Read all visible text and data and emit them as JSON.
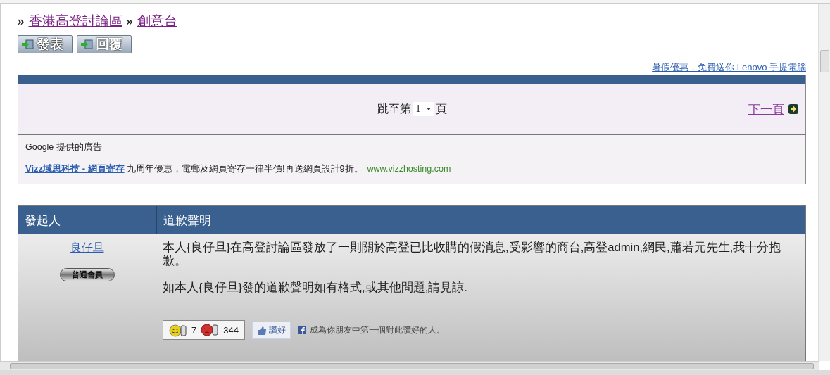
{
  "breadcrumb": [
    {
      "kind": "sep",
      "text": "»"
    },
    {
      "kind": "link",
      "text": "香港高登討論區"
    },
    {
      "kind": "sep",
      "text": "»"
    },
    {
      "kind": "link",
      "text": "創意台"
    }
  ],
  "actions": [
    {
      "label": "發表"
    },
    {
      "label": "回覆"
    }
  ],
  "promo_link": "暑假優惠，免費送你 Lenovo 手提電腦",
  "pager": {
    "prefix": "跳至第",
    "page": "1",
    "suffix": "頁",
    "next": "下一頁"
  },
  "ads": {
    "heading": "Google 提供的廣告",
    "title": "Vizz域思科技 - 網頁寄存",
    "text": "九周年優惠，電郵及網頁寄存一律半價!再送網頁設計9折。",
    "url": "www.vizzhosting.com"
  },
  "post": {
    "columns": [
      "發起人",
      "道歉聲明"
    ],
    "author": "良仔旦",
    "rank": "普通會員",
    "paragraphs": [
      "本人{良仔旦}在高登討論區發放了一則關於高登已比收購的假消息,受影響的商台,高登admin,網民,蕭若元先生,我十分抱歉。",
      "如本人{良仔旦}發的道歉聲明如有格式,或其他問題,請見諒."
    ],
    "good": "7",
    "bad": "344",
    "like": "讚好",
    "like_text": "成為你朋友中第一個對此讚好的人。"
  }
}
